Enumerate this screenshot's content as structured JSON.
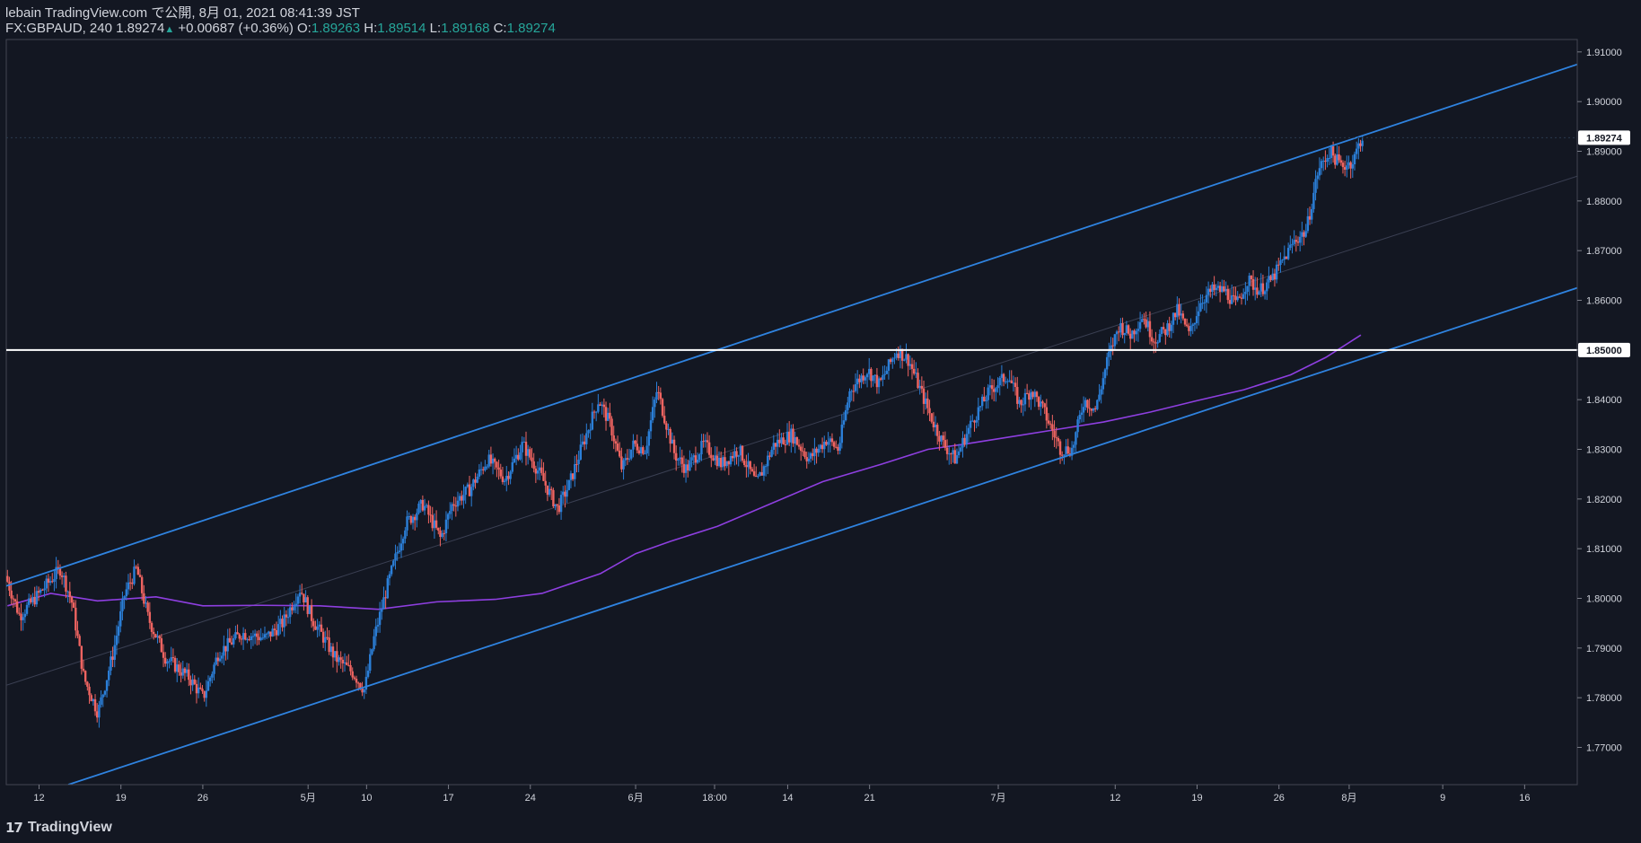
{
  "header": {
    "published": "lebain TradingView.com で公開, 8月 01, 2021 08:41:39 JST",
    "symbol": "FX:GBPAUD, 240",
    "last": "1.89274",
    "change_arrow": "▲",
    "change": "+0.00687 (+0.36%)",
    "o_label": "O:",
    "o_value": "1.89263",
    "h_label": "H:",
    "h_value": "1.89514",
    "l_label": "L:",
    "l_value": "1.89168",
    "c_label": "C:",
    "c_value": "1.89274"
  },
  "colors": {
    "background": "#131722",
    "up_candle": "#2b7fd8",
    "down_candle": "#ef6461",
    "channel": "#2f83e0",
    "moving_average": "#8e3fe0",
    "horizontal_level": "#ffffff",
    "grid": "#2a2e39",
    "text": "#d1d4dc",
    "price_tag_bg": "#ffffff",
    "price_tag_text": "#131722"
  },
  "footer": {
    "logo_icon": "tradingview-logo-icon",
    "brand": "TradingView"
  },
  "chart_data": {
    "type": "candlestick",
    "symbol": "GBPAUD",
    "timeframe": "240",
    "ylim": [
      1.7625,
      1.9125
    ],
    "y_ticks": [
      "1.91000",
      "1.90000",
      "1.89000",
      "1.88000",
      "1.87000",
      "1.86000",
      "1.85000",
      "1.84000",
      "1.83000",
      "1.82000",
      "1.81000",
      "1.80000",
      "1.79000",
      "1.78000",
      "1.77000"
    ],
    "current_price_label": "1.89274",
    "current_price": 1.89274,
    "horizontal_level_label": "1.85000",
    "horizontal_level": 1.85,
    "x_ticks": [
      {
        "label": "12",
        "day": 12
      },
      {
        "label": "19",
        "day": 19
      },
      {
        "label": "26",
        "day": 26
      },
      {
        "label": "5月",
        "day": 35
      },
      {
        "label": "10",
        "day": 40
      },
      {
        "label": "17",
        "day": 47
      },
      {
        "label": "24",
        "day": 54
      },
      {
        "label": "6月",
        "day": 63
      },
      {
        "label": "18:00",
        "day": 69.75
      },
      {
        "label": "14",
        "day": 76
      },
      {
        "label": "21",
        "day": 83
      },
      {
        "label": "7月",
        "day": 94
      },
      {
        "label": "12",
        "day": 104
      },
      {
        "label": "19",
        "day": 111
      },
      {
        "label": "26",
        "day": 118
      },
      {
        "label": "8月",
        "day": 124
      },
      {
        "label": "9",
        "day": 132
      },
      {
        "label": "16",
        "day": 139
      }
    ],
    "xlim_days": [
      9.2,
      143.5
    ],
    "price_path": [
      [
        9.3,
        1.8045
      ],
      [
        10.5,
        1.7965
      ],
      [
        12,
        1.8005
      ],
      [
        14,
        1.806
      ],
      [
        15,
        1.799
      ],
      [
        16,
        1.784
      ],
      [
        17.2,
        1.777
      ],
      [
        18.5,
        1.789
      ],
      [
        19.5,
        1.801
      ],
      [
        20.5,
        1.806
      ],
      [
        21.5,
        1.796
      ],
      [
        23,
        1.788
      ],
      [
        25,
        1.784
      ],
      [
        26.2,
        1.78
      ],
      [
        27.5,
        1.789
      ],
      [
        29.5,
        1.793
      ],
      [
        31.5,
        1.792
      ],
      [
        33,
        1.795
      ],
      [
        34.5,
        1.802
      ],
      [
        35.5,
        1.796
      ],
      [
        37.5,
        1.788
      ],
      [
        39,
        1.785
      ],
      [
        40,
        1.7815
      ],
      [
        40.8,
        1.792
      ],
      [
        42,
        1.803
      ],
      [
        43.5,
        1.815
      ],
      [
        45,
        1.819
      ],
      [
        46.5,
        1.812
      ],
      [
        47.5,
        1.819
      ],
      [
        49,
        1.822
      ],
      [
        50.5,
        1.828
      ],
      [
        52,
        1.824
      ],
      [
        53.5,
        1.831
      ],
      [
        55,
        1.825
      ],
      [
        56.5,
        1.818
      ],
      [
        57.5,
        1.823
      ],
      [
        58.5,
        1.83
      ],
      [
        60,
        1.84
      ],
      [
        61,
        1.835
      ],
      [
        62,
        1.826
      ],
      [
        63,
        1.831
      ],
      [
        64,
        1.83
      ],
      [
        65,
        1.842
      ],
      [
        66.5,
        1.829
      ],
      [
        67.5,
        1.826
      ],
      [
        69,
        1.831
      ],
      [
        70.5,
        1.827
      ],
      [
        72,
        1.83
      ],
      [
        73.5,
        1.823
      ],
      [
        75,
        1.831
      ],
      [
        76.5,
        1.833
      ],
      [
        78,
        1.828
      ],
      [
        79.5,
        1.832
      ],
      [
        80.5,
        1.83
      ],
      [
        81.5,
        1.842
      ],
      [
        83,
        1.846
      ],
      [
        84,
        1.843
      ],
      [
        85.5,
        1.85
      ],
      [
        86.5,
        1.848
      ],
      [
        87.5,
        1.842
      ],
      [
        88.5,
        1.836
      ],
      [
        89.5,
        1.831
      ],
      [
        90.5,
        1.828
      ],
      [
        92,
        1.836
      ],
      [
        93.5,
        1.842
      ],
      [
        95,
        1.845
      ],
      [
        96,
        1.839
      ],
      [
        97,
        1.842
      ],
      [
        98,
        1.838
      ],
      [
        99.5,
        1.83
      ],
      [
        100.5,
        1.83
      ],
      [
        101.5,
        1.84
      ],
      [
        102.5,
        1.838
      ],
      [
        103.5,
        1.848
      ],
      [
        104.5,
        1.855
      ],
      [
        105.5,
        1.853
      ],
      [
        106.5,
        1.857
      ],
      [
        107.5,
        1.852
      ],
      [
        108.5,
        1.854
      ],
      [
        109.5,
        1.858
      ],
      [
        110.5,
        1.853
      ],
      [
        111.5,
        1.86
      ],
      [
        112.5,
        1.862
      ],
      [
        113.5,
        1.862
      ],
      [
        114.5,
        1.859
      ],
      [
        115.5,
        1.864
      ],
      [
        116.5,
        1.862
      ],
      [
        117.5,
        1.864
      ],
      [
        118.5,
        1.868
      ],
      [
        119.5,
        1.872
      ],
      [
        120.5,
        1.874
      ],
      [
        121.5,
        1.886
      ],
      [
        122.5,
        1.89
      ],
      [
        123.5,
        1.887
      ],
      [
        124.5,
        1.888
      ],
      [
        125.2,
        1.8927
      ]
    ],
    "ma_path": [
      [
        9.3,
        1.7985
      ],
      [
        13,
        1.801
      ],
      [
        17,
        1.7995
      ],
      [
        22,
        1.8003
      ],
      [
        26,
        1.7985
      ],
      [
        31,
        1.7986
      ],
      [
        36,
        1.7985
      ],
      [
        41,
        1.7978
      ],
      [
        46,
        1.7993
      ],
      [
        51,
        1.7998
      ],
      [
        55,
        1.801
      ],
      [
        60,
        1.805
      ],
      [
        63,
        1.809
      ],
      [
        66,
        1.8115
      ],
      [
        70,
        1.8145
      ],
      [
        74,
        1.8185
      ],
      [
        79,
        1.8235
      ],
      [
        84,
        1.827
      ],
      [
        88,
        1.83
      ],
      [
        91,
        1.831
      ],
      [
        95,
        1.8325
      ],
      [
        99,
        1.834
      ],
      [
        103,
        1.8355
      ],
      [
        107,
        1.8375
      ],
      [
        111,
        1.8398
      ],
      [
        115,
        1.842
      ],
      [
        119,
        1.845
      ],
      [
        122,
        1.8485
      ],
      [
        125,
        1.853
      ]
    ],
    "upper_channel": [
      [
        9.2,
        1.8025
      ],
      [
        143.5,
        1.9075
      ]
    ],
    "lower_channel": [
      [
        14.5,
        1.7625
      ],
      [
        143.5,
        1.8625
      ]
    ],
    "mid_channel": [
      [
        9.2,
        1.7825
      ],
      [
        143.5,
        1.885
      ]
    ]
  }
}
